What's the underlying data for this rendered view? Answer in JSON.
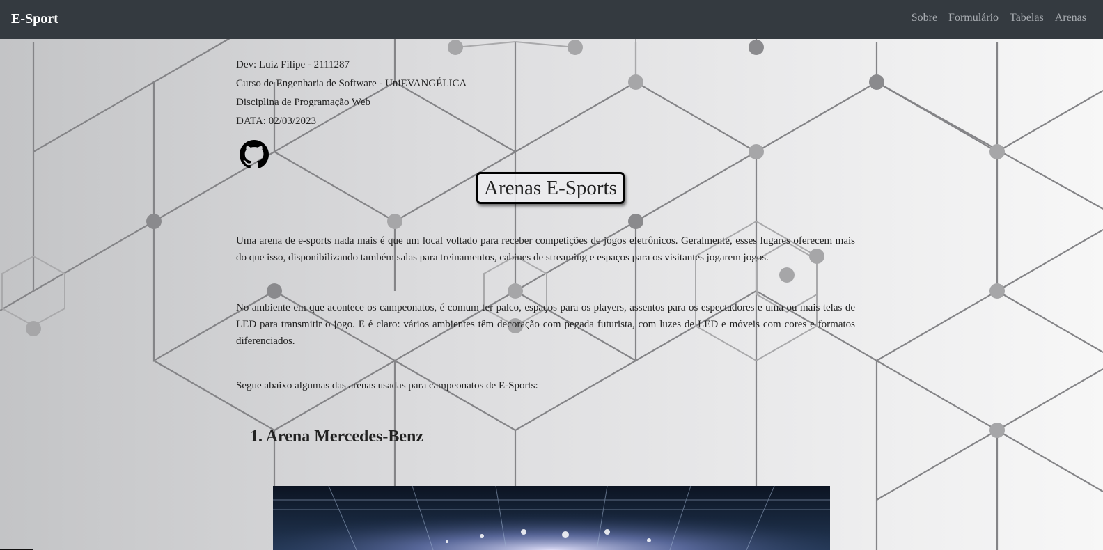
{
  "navbar": {
    "brand": "E-Sport",
    "links": [
      "Sobre",
      "Formulário",
      "Tabelas",
      "Arenas"
    ]
  },
  "info": {
    "dev": "Dev: Luiz Filipe - 2111287",
    "curso": "Curso de Engenharia de Software - UniEVANGÉLICA",
    "disciplina": "Disciplina de Programação Web",
    "data": "DATA: 02/03/2023",
    "github_icon": "github-icon"
  },
  "main": {
    "title": "Arenas E-Sports",
    "paragraphs": [
      "Uma arena de e-sports nada mais é que um local voltado para receber competições de jogos eletrônicos. Geralmente, esses lugares oferecem mais do que isso, disponibilizando também salas para treinamentos, cabines de streaming e espaços para os visitantes jogarem jogos.",
      "No ambiente em que acontece os campeonatos, é comum ter palco, espaços para os players, assentos para os espectadores e uma ou mais telas de LED para transmitir o jogo. E é claro: vários ambientes têm decoração com pegada futurista, com luzes de LED e móveis com cores e formatos diferenciados.",
      "Segue abaixo algumas das arenas usadas para campeonatos de E-Sports:"
    ],
    "arenas": [
      {
        "heading": "1. Arena Mercedes-Benz"
      }
    ]
  },
  "colors": {
    "navbar_bg": "#343a40",
    "brand": "#ffffff",
    "nav_link": "#a8acb1",
    "text": "#222222",
    "hex_line": "#7d7d80",
    "hex_node": "#8a8a8d"
  }
}
